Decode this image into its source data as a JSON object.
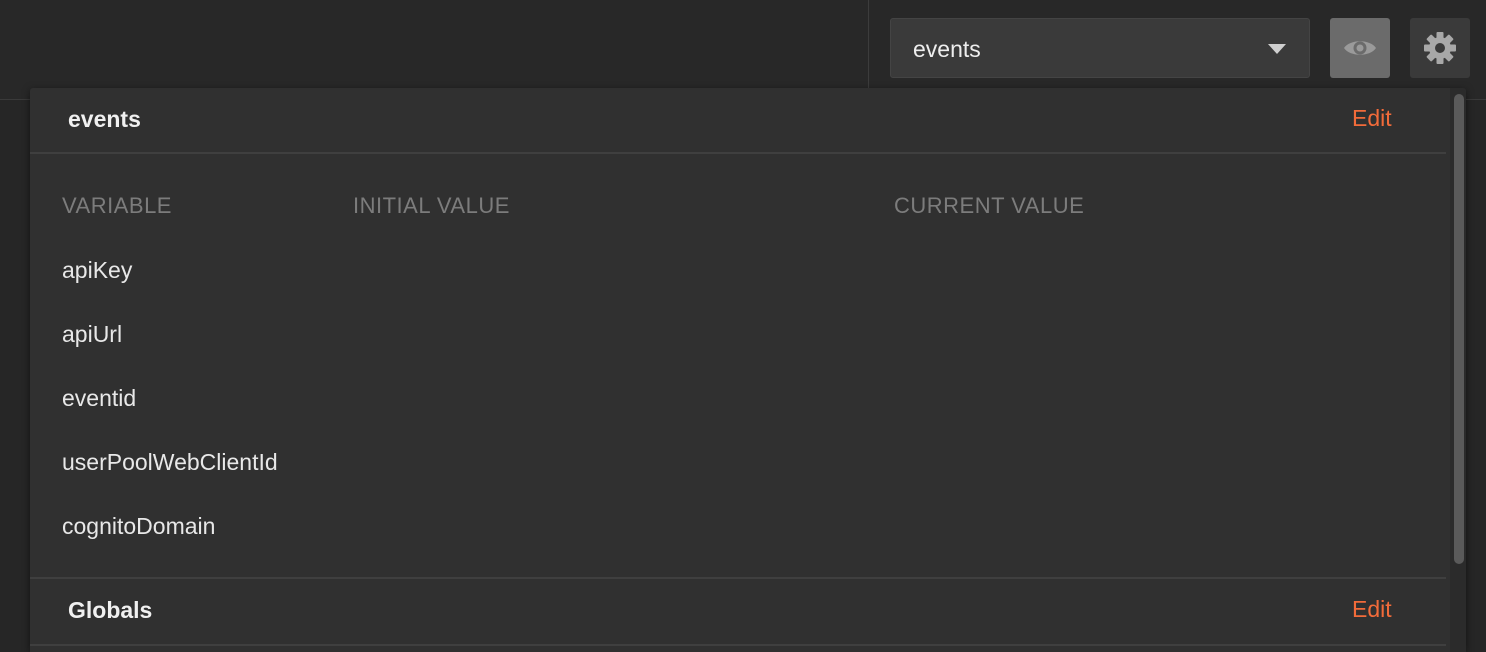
{
  "header": {
    "environment_select": {
      "selected": "events"
    },
    "icons": {
      "quick_look": "eye-icon",
      "settings": "gear-icon",
      "dropdown": "chevron-down-icon"
    }
  },
  "environment_section": {
    "title": "events",
    "edit_label": "Edit",
    "columns": [
      "VARIABLE",
      "INITIAL VALUE",
      "CURRENT VALUE"
    ],
    "rows": [
      {
        "variable": "apiKey",
        "initial": "",
        "current": ""
      },
      {
        "variable": "apiUrl",
        "initial": "",
        "current": ""
      },
      {
        "variable": "eventid",
        "initial": "",
        "current": ""
      },
      {
        "variable": "userPoolWebClientId",
        "initial": "",
        "current": ""
      },
      {
        "variable": "cognitoDomain",
        "initial": "",
        "current": ""
      }
    ]
  },
  "globals_section": {
    "title": "Globals",
    "edit_label": "Edit"
  },
  "colors": {
    "accent": "#f26b3a",
    "background": "#262626",
    "panel": "#303030"
  }
}
